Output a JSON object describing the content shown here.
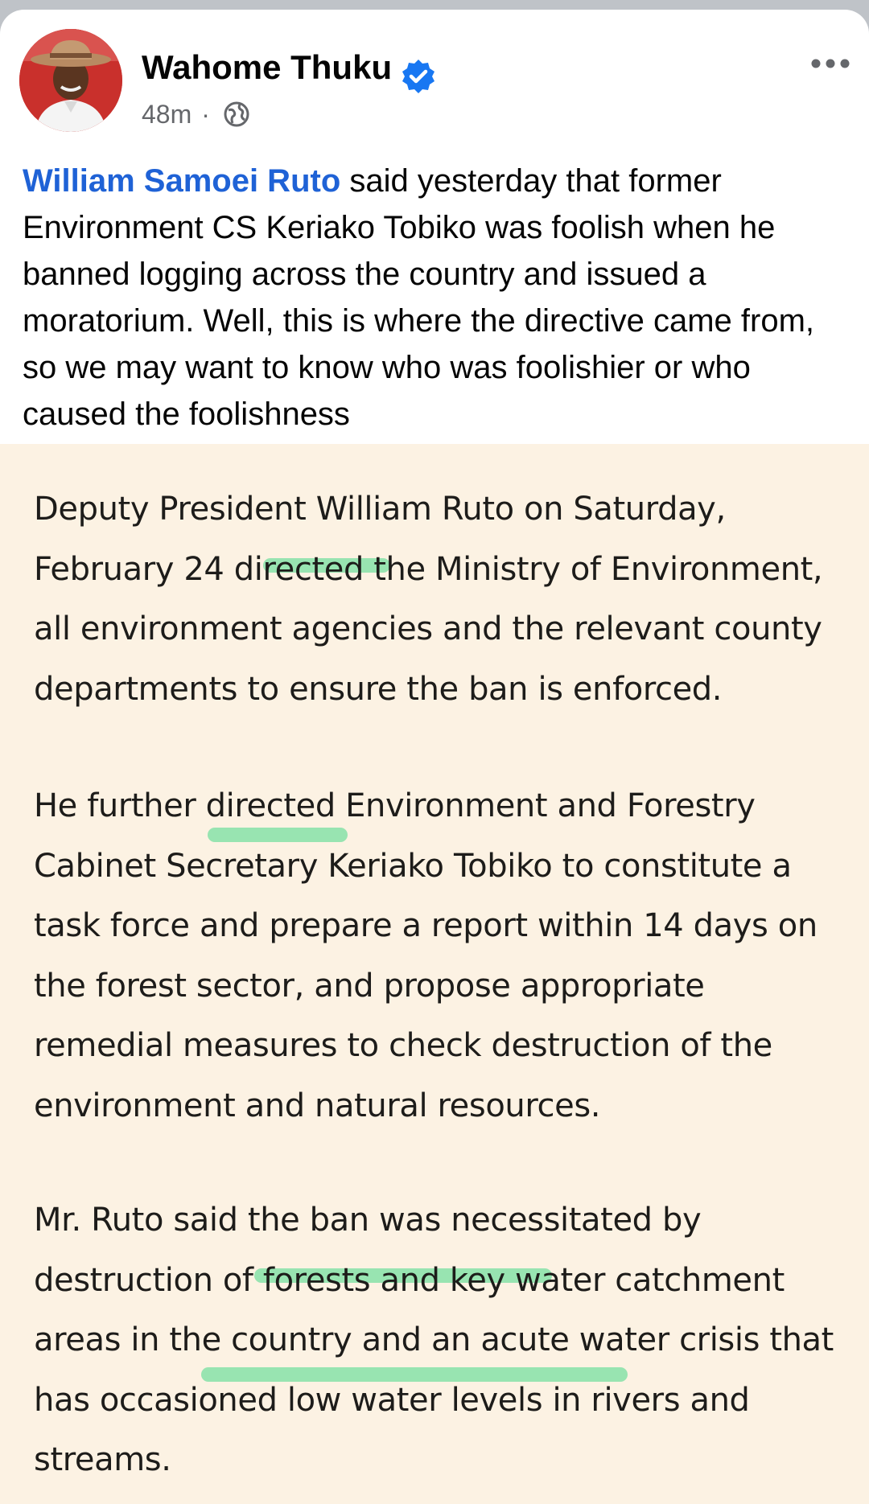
{
  "post": {
    "author": "Wahome Thuku",
    "time": "48m",
    "separator": "·",
    "mention": "William Samoei Ruto",
    "text": " said yesterday that former Environment CS Keriako Tobiko was foolish when he banned logging across the country and issued a moratorium. Well, this is where the directive came from, so we may want to know who was foolishier or who caused the foolishness"
  },
  "icons": {
    "verified": "verified-badge-icon",
    "privacy": "globe-icon",
    "more": "more-options-icon"
  },
  "colors": {
    "mention": "#1f62d6",
    "verified": "#1877f2",
    "article_background": "#fcf2e3",
    "highlight": "#7ee0a4"
  },
  "article": {
    "paragraph_1": "Deputy President William Ruto on Saturday, February 24 directed the Ministry of Environment, all environment agencies and the relevant county departments to ensure the ban is enforced.",
    "paragraph_2": "He further directed Environment and Forestry Cabinet Secretary Keriako Tobiko to constitute a task force and prepare a report within 14 days on the forest sector, and propose appropriate remedial measures to check destruction of the environment and natural resources.",
    "paragraph_3": "Mr. Ruto said the ban was necessitated by destruction of forests and key water catchment areas in the country and an acute water crisis that has occasioned low water levels in rivers and streams."
  }
}
